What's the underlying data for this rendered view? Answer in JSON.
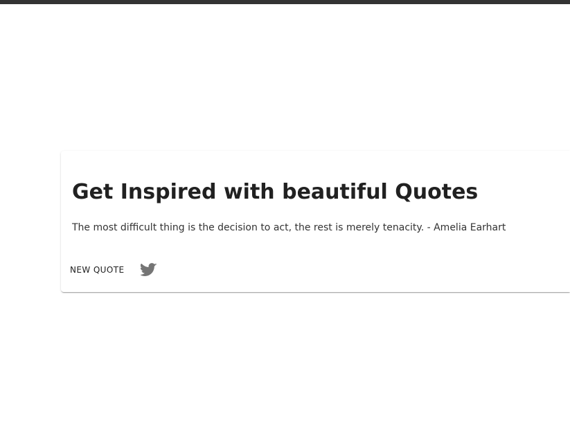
{
  "card": {
    "title": "Get Inspired with beautiful Quotes",
    "quote": "The most difficult thing is the decision to act, the rest is merely tenacity. - Amelia Earhart"
  },
  "actions": {
    "new_quote_label": "NEW QUOTE",
    "tweet_icon": "twitter-icon"
  },
  "colors": {
    "top_bar": "#333333",
    "title": "#212121",
    "text": "#333333",
    "icon": "#757575"
  }
}
